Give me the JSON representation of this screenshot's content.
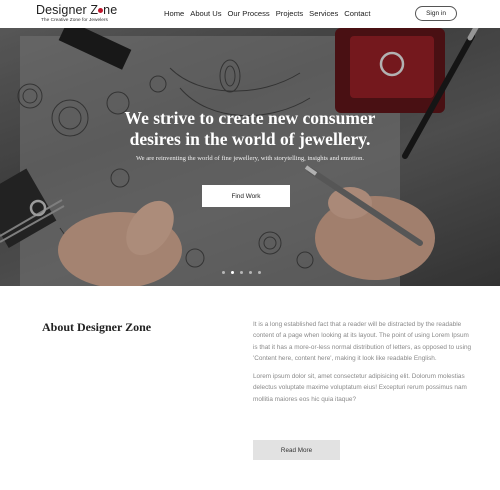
{
  "header": {
    "logo_title_pre": "Designer Z",
    "logo_title_post": "ne",
    "logo_tagline": "The Creative Zone for Jewelers",
    "nav": [
      {
        "label": "Home"
      },
      {
        "label": "About Us"
      },
      {
        "label": "Our Process"
      },
      {
        "label": "Projects"
      },
      {
        "label": "Services"
      },
      {
        "label": "Contact"
      }
    ],
    "signin_label": "Sign in",
    "logo_dot_color": "#c0172c"
  },
  "hero": {
    "title": "We strive to create new consumer desires in the world of jewellery.",
    "subtitle": "We are reinventing the world of fine jewellery, with storytelling, insights and emotion.",
    "cta_label": "Find Work",
    "slides_count": 5,
    "active_slide": 1
  },
  "about": {
    "title": "About Designer Zone",
    "paragraphs": [
      "It is a long established fact that a reader will be distracted by the readable content of a page when looking at its layout. The point of using Lorem Ipsum is that it has a more-or-less normal distribution of letters, as opposed to using 'Content here, content here', making it look like readable English.",
      "Lorem ipsum dolor sit, amet consectetur adipisicing elit. Dolorum molestias delectus voluptate maxime voluptatum eius! Excepturi rerum possimus nam mollitia maiores eos hic quia itaque?"
    ],
    "cta_label": "Read More"
  }
}
